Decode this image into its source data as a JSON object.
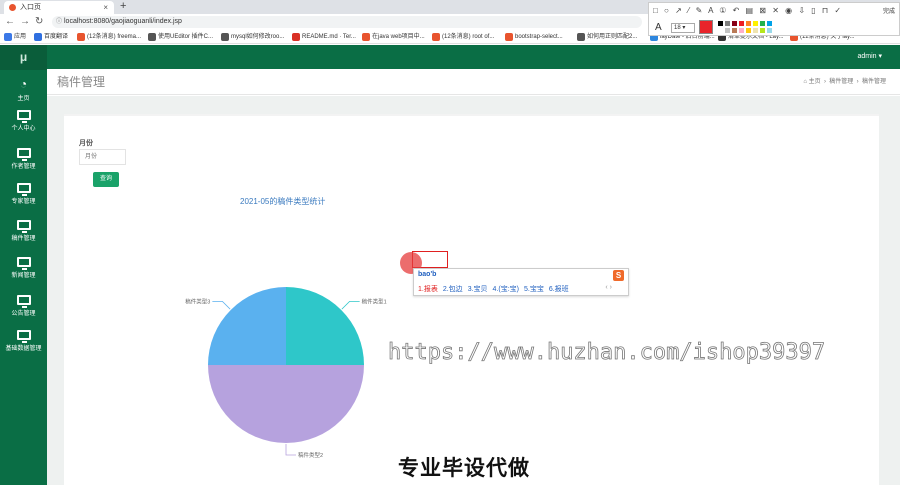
{
  "browser": {
    "tab_title": "入口页",
    "tab_close": "×",
    "new_tab": "+",
    "url": "localhost:8080/gaojiaoguanli/index.jsp",
    "bookmarks": [
      {
        "label": "应用",
        "color": "#3b78e7"
      },
      {
        "label": "百度翻译",
        "color": "#2f6fe0"
      },
      {
        "label": "(12条消息) freema...",
        "color": "#e8542e"
      },
      {
        "label": "使用UEditor 插件C...",
        "color": "#555555"
      },
      {
        "label": "mysql如何修改roo...",
        "color": "#555555"
      },
      {
        "label": "README.md · Ter...",
        "color": "#d93025"
      },
      {
        "label": "在java web项目中...",
        "color": "#e8542e"
      },
      {
        "label": "(12条消息) root of...",
        "color": "#e8542e"
      },
      {
        "label": "bootstrap-select...",
        "color": "#e8542e"
      },
      {
        "label": "如何用正则匹配2...",
        "color": "#555555"
      },
      {
        "label": "layDate - 后台前端...",
        "color": "#2e86de"
      },
      {
        "label": "清单提示文档 - Lay...",
        "color": "#333333"
      },
      {
        "label": "(12条消息) 关于lay...",
        "color": "#e8542e"
      }
    ]
  },
  "snap_tool": {
    "icons": "□ ○ ↗ ⁄ ✎ A ① ↶ ▤ ⊠ ✕ ◉ ⇩ ▯ ⊓ ✓",
    "finish": "完成",
    "font_letter": "A",
    "size_value": "18 ▾",
    "current_color": "#e8242a",
    "palette": [
      "#000000",
      "#7f7f7f",
      "#880015",
      "#ed1c24",
      "#ff7f27",
      "#fff200",
      "#22b14c",
      "#00a2e8",
      "#ffffff",
      "#c3c3c3",
      "#b97a57",
      "#ffaec9",
      "#ffc90e",
      "#efe4b0",
      "#b5e61d",
      "#99d9ea"
    ]
  },
  "app": {
    "brand": "μ",
    "admin_label": "admin ▾",
    "sidebar": [
      {
        "label": "主页",
        "icon": "dashboard-icon"
      },
      {
        "label": "个人中心",
        "icon": "monitor-icon"
      },
      {
        "label": "作者管理",
        "icon": "monitor-icon"
      },
      {
        "label": "专家管理",
        "icon": "monitor-icon"
      },
      {
        "label": "稿件管理",
        "icon": "monitor-icon"
      },
      {
        "label": "新闻管理",
        "icon": "monitor-icon"
      },
      {
        "label": "公告管理",
        "icon": "monitor-icon"
      },
      {
        "label": "基础数据管理",
        "icon": "monitor-icon"
      }
    ],
    "page_title": "稿件管理",
    "breadcrumb": [
      "主页",
      "稿件管理",
      "稿件管理"
    ],
    "filter": {
      "label": "月份",
      "placeholder": "月份",
      "query_button": "查询"
    }
  },
  "chart_data": {
    "type": "pie",
    "title": "2021-05的稿件类型统计",
    "slices": [
      {
        "name": "稿件类型1",
        "value": 1,
        "color": "#2ec7c9"
      },
      {
        "name": "稿件类型2",
        "value": 2,
        "color": "#b6a2de"
      },
      {
        "name": "稿件类型3",
        "value": 1,
        "color": "#5ab1ef"
      }
    ]
  },
  "ime": {
    "pinyin": "bao'b",
    "candidates": [
      "1.报表",
      "2.包边",
      "3.宝贝",
      "4.(宝:宝)",
      "5.宝宝",
      "6.报班"
    ],
    "arrows": "‹ ›",
    "logo": "S"
  },
  "watermark": "https://www.huzhan.com/ishop39397",
  "banner": "专业毕设代做"
}
